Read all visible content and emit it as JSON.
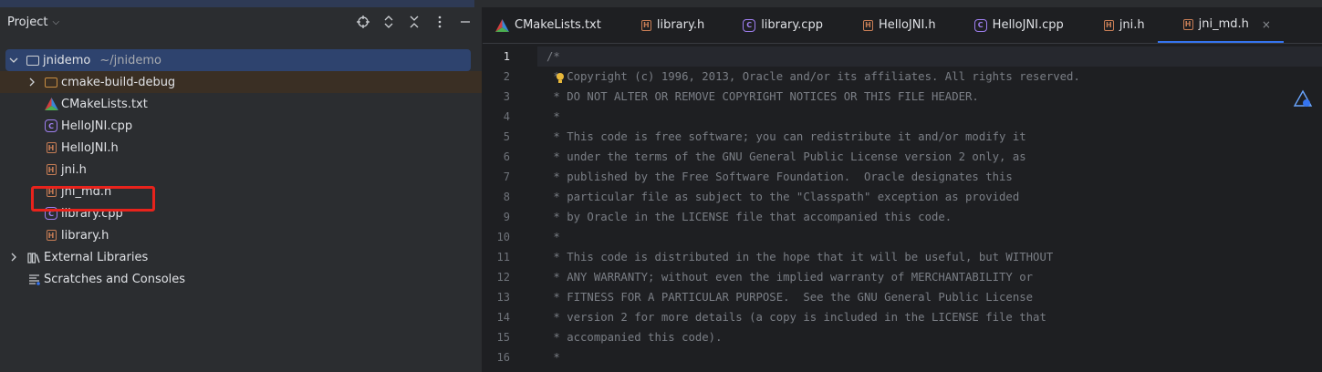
{
  "project_panel": {
    "title": "Project",
    "tree": [
      {
        "label": "jnidemo",
        "path": "~/jnidemo",
        "icon": "module-folder-icon",
        "expanded": true
      },
      {
        "label": "cmake-build-debug",
        "icon": "folder-icon",
        "expanded": false
      },
      {
        "label": "CMakeLists.txt",
        "icon": "cmake-icon"
      },
      {
        "label": "HelloJNI.cpp",
        "icon": "cpp-file-icon"
      },
      {
        "label": "HelloJNI.h",
        "icon": "header-file-icon"
      },
      {
        "label": "jni.h",
        "icon": "header-file-icon"
      },
      {
        "label": "jni_md.h",
        "icon": "header-file-icon"
      },
      {
        "label": "library.cpp",
        "icon": "cpp-file-icon"
      },
      {
        "label": "library.h",
        "icon": "header-file-icon"
      },
      {
        "label": "External Libraries",
        "icon": "library-icon",
        "expanded": false
      },
      {
        "label": "Scratches and Consoles",
        "icon": "scratches-icon"
      }
    ]
  },
  "editor": {
    "tabs": [
      {
        "label": "CMakeLists.txt",
        "icon": "cmake-icon"
      },
      {
        "label": "library.h",
        "icon": "header-file-icon"
      },
      {
        "label": "library.cpp",
        "icon": "cpp-file-icon"
      },
      {
        "label": "HelloJNI.h",
        "icon": "header-file-icon"
      },
      {
        "label": "HelloJNI.cpp",
        "icon": "cpp-file-icon"
      },
      {
        "label": "jni.h",
        "icon": "header-file-icon"
      },
      {
        "label": "jni_md.h",
        "icon": "header-file-icon",
        "active": true,
        "close": "×"
      }
    ],
    "line_numbers": [
      "1",
      "2",
      "3",
      "4",
      "5",
      "6",
      "7",
      "8",
      "9",
      "10",
      "11",
      "12",
      "13",
      "14",
      "15",
      "16"
    ],
    "lines": [
      "/*",
      " * Copyright (c) 1996, 2013, Oracle and/or its affiliates. All rights reserved.",
      " * DO NOT ALTER OR REMOVE COPYRIGHT NOTICES OR THIS FILE HEADER.",
      " *",
      " * This code is free software; you can redistribute it and/or modify it",
      " * under the terms of the GNU General Public License version 2 only, as",
      " * published by the Free Software Foundation.  Oracle designates this",
      " * particular file as subject to the \"Classpath\" exception as provided",
      " * by Oracle in the LICENSE file that accompanied this code.",
      " *",
      " * This code is distributed in the hope that it will be useful, but WITHOUT",
      " * ANY WARRANTY; without even the implied warranty of MERCHANTABILITY or",
      " * FITNESS FOR A PARTICULAR PURPOSE.  See the GNU General Public License",
      " * version 2 for more details (a copy is included in the LICENSE file that",
      " * accompanied this code).",
      " *"
    ]
  },
  "colors": {
    "accent": "#3574f0",
    "highlight_box": "#e8231c",
    "header_icon": "#c77d55",
    "cpp_icon": "#9f7ff0"
  }
}
